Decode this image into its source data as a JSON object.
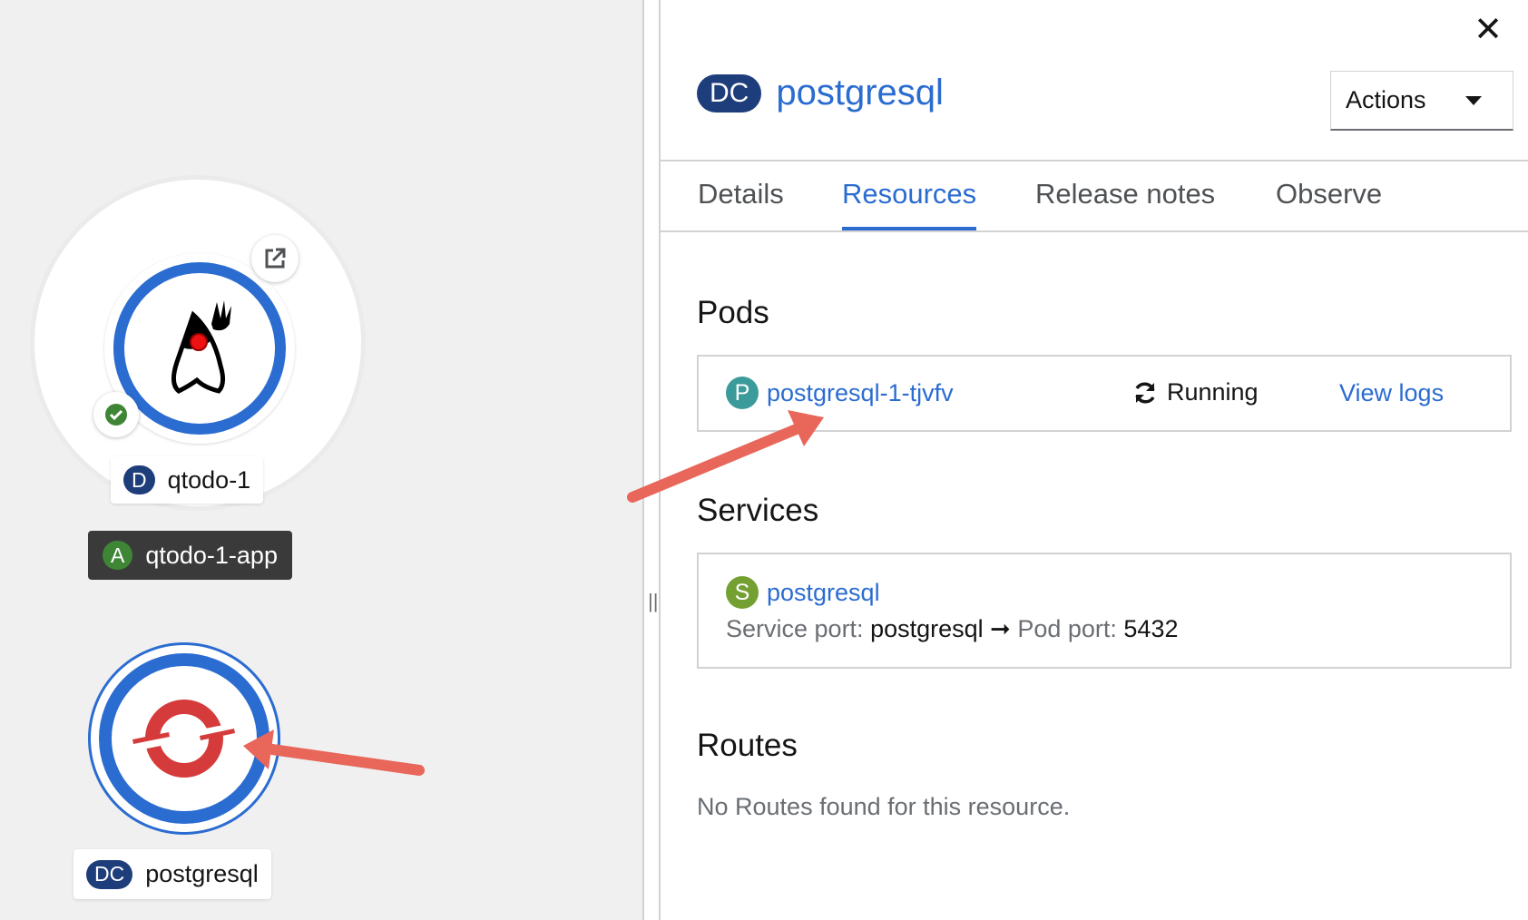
{
  "topology": {
    "application_group": {
      "badge": "A",
      "label": "qtodo-1-app"
    },
    "nodes": [
      {
        "id": "qtodo",
        "badge": "D",
        "label": "qtodo-1",
        "status": "ready",
        "icon": "java-duke-icon"
      },
      {
        "id": "postgresql",
        "badge": "DC",
        "label": "postgresql",
        "icon": "openshift-icon"
      }
    ]
  },
  "panel": {
    "close_label": "✕",
    "header": {
      "badge": "DC",
      "title": "postgresql"
    },
    "actions_label": "Actions",
    "tabs": [
      {
        "label": "Details",
        "active": false
      },
      {
        "label": "Resources",
        "active": true
      },
      {
        "label": "Release notes",
        "active": false
      },
      {
        "label": "Observe",
        "active": false
      }
    ],
    "pods": {
      "title": "Pods",
      "items": [
        {
          "badge": "P",
          "name": "postgresql-1-tjvfv",
          "status": "Running",
          "logs_label": "View logs"
        }
      ]
    },
    "services": {
      "title": "Services",
      "items": [
        {
          "badge": "S",
          "name": "postgresql",
          "service_port_label": "Service port:",
          "service_port": "postgresql",
          "arrow": "➞",
          "pod_port_label": "Pod port:",
          "pod_port": "5432"
        }
      ]
    },
    "routes": {
      "title": "Routes",
      "empty_text": "No Routes found for this resource."
    }
  },
  "colors": {
    "link": "#2b6cd1",
    "dc_badge": "#1e3d7b",
    "app_badge": "#3e8635",
    "pod_badge": "#3b9a9a",
    "service_badge": "#73a031",
    "annotation_arrow": "#e8665a",
    "node_ring": "#2b6cd1"
  }
}
